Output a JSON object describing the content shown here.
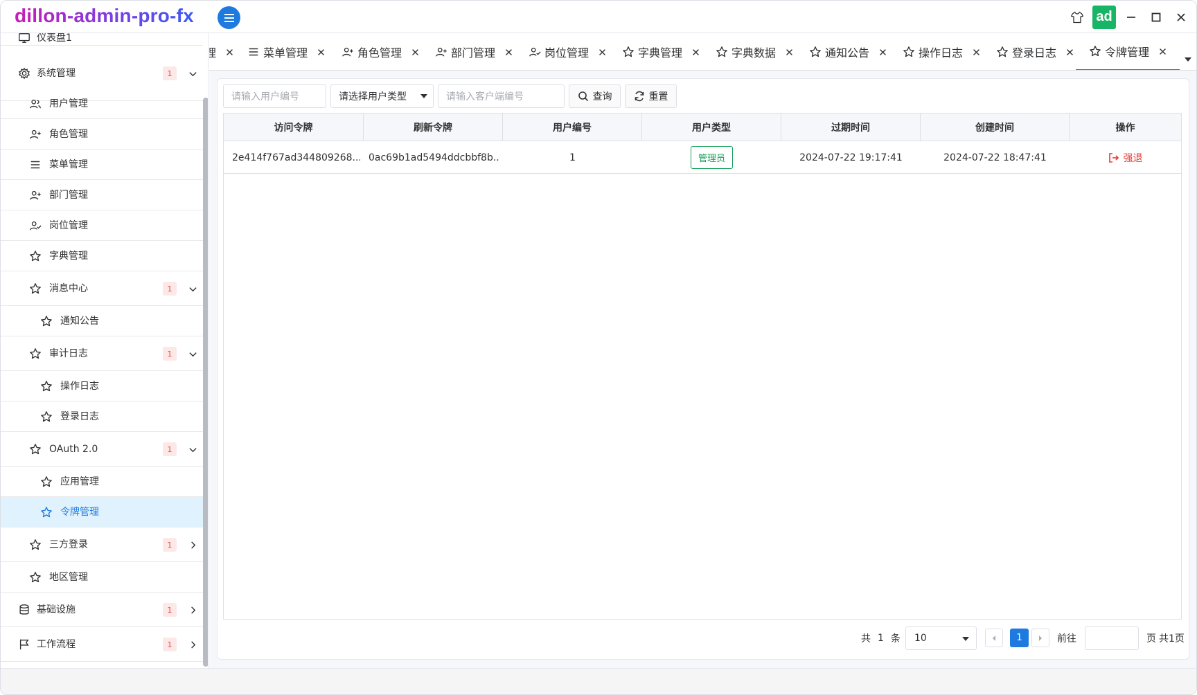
{
  "app": {
    "title": "dillon-admin-pro-fx",
    "avatar_text": "ad"
  },
  "sidebar": {
    "items": [
      {
        "label": "仪表盘1",
        "icon": "monitor-icon"
      },
      {
        "label": "系统管理",
        "icon": "gear-icon",
        "badge": "1",
        "expanded": true
      },
      {
        "label": "用户管理",
        "icon": "users-icon"
      },
      {
        "label": "角色管理",
        "icon": "user-plus-icon"
      },
      {
        "label": "菜单管理",
        "icon": "list-icon"
      },
      {
        "label": "部门管理",
        "icon": "user-plus-icon"
      },
      {
        "label": "岗位管理",
        "icon": "user-check-icon"
      },
      {
        "label": "字典管理",
        "icon": "star-icon"
      },
      {
        "label": "消息中心",
        "icon": "star-icon",
        "badge": "1",
        "expanded": true
      },
      {
        "label": "通知公告",
        "icon": "star-icon"
      },
      {
        "label": "审计日志",
        "icon": "star-icon",
        "badge": "1",
        "expanded": true
      },
      {
        "label": "操作日志",
        "icon": "star-icon"
      },
      {
        "label": "登录日志",
        "icon": "star-icon"
      },
      {
        "label": "OAuth 2.0",
        "icon": "star-icon",
        "badge": "1",
        "expanded": true
      },
      {
        "label": "应用管理",
        "icon": "star-icon"
      },
      {
        "label": "令牌管理",
        "icon": "star-icon",
        "active": true
      },
      {
        "label": "三方登录",
        "icon": "star-icon",
        "badge": "1",
        "expanded": false
      },
      {
        "label": "地区管理",
        "icon": "star-icon"
      },
      {
        "label": "基础设施",
        "icon": "database-icon",
        "badge": "1",
        "expanded": false
      },
      {
        "label": "工作流程",
        "icon": "flag-icon",
        "badge": "1",
        "expanded": false
      }
    ]
  },
  "tabs": [
    {
      "label": "理",
      "icon": ""
    },
    {
      "label": "菜单管理",
      "icon": "list-icon"
    },
    {
      "label": "角色管理",
      "icon": "user-plus-icon"
    },
    {
      "label": "部门管理",
      "icon": "user-plus-icon"
    },
    {
      "label": "岗位管理",
      "icon": "user-check-icon"
    },
    {
      "label": "字典管理",
      "icon": "star-icon"
    },
    {
      "label": "字典数据",
      "icon": "star-icon"
    },
    {
      "label": "通知公告",
      "icon": "star-icon"
    },
    {
      "label": "操作日志",
      "icon": "star-icon"
    },
    {
      "label": "登录日志",
      "icon": "star-icon"
    },
    {
      "label": "令牌管理",
      "icon": "star-icon",
      "active": true
    }
  ],
  "search": {
    "user_id_placeholder": "请输入用户编号",
    "user_type_value": "请选择用户类型",
    "client_id_placeholder": "请输入客户端编号",
    "query_label": "查询",
    "reset_label": "重置"
  },
  "table": {
    "columns": [
      "访问令牌",
      "刷新令牌",
      "用户编号",
      "用户类型",
      "过期时间",
      "创建时间",
      "操作"
    ],
    "rows": [
      {
        "access_token": "2e414f767ad344809268...",
        "refresh_token": "0ac69b1ad5494ddcbbf8b...",
        "user_id": "1",
        "user_type": "管理员",
        "expire_time": "2024-07-22 19:17:41",
        "create_time": "2024-07-22 18:47:41",
        "action": "强退"
      }
    ]
  },
  "pagination": {
    "total_prefix": "共",
    "total": "1",
    "total_suffix": "条",
    "page_size": "10",
    "current_page": "1",
    "goto_label": "前往",
    "page_suffix": "页",
    "total_pages": "共1页"
  },
  "colors": {
    "accent": "#1f7ae0",
    "success": "#18a058",
    "danger": "#e53935",
    "badge_bg": "#fde8e8"
  }
}
